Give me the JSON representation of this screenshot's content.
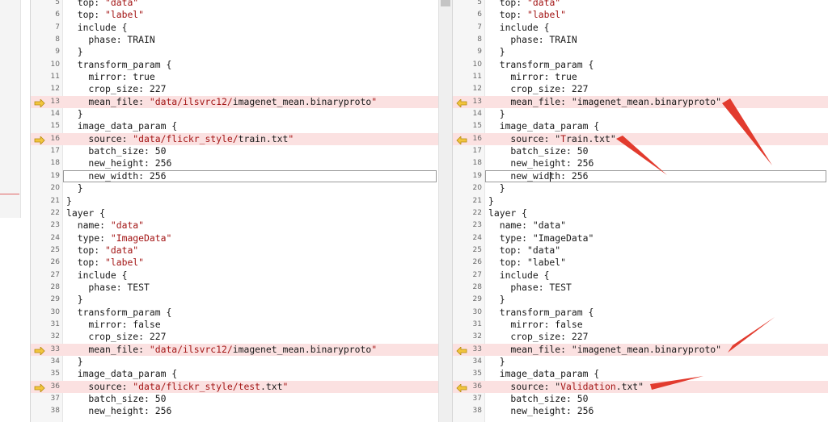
{
  "left_pane": {
    "lines": [
      {
        "n": "5",
        "segs": [
          {
            "t": "  top: "
          },
          {
            "t": "\"data\"",
            "s": 1
          }
        ]
      },
      {
        "n": "6",
        "segs": [
          {
            "t": "  top: "
          },
          {
            "t": "\"label\"",
            "s": 1
          }
        ]
      },
      {
        "n": "7",
        "segs": [
          {
            "t": "  include {"
          }
        ]
      },
      {
        "n": "8",
        "segs": [
          {
            "t": "    phase: TRAIN"
          }
        ]
      },
      {
        "n": "9",
        "segs": [
          {
            "t": "  }"
          }
        ]
      },
      {
        "n": "10",
        "segs": [
          {
            "t": "  transform_param {"
          }
        ]
      },
      {
        "n": "11",
        "segs": [
          {
            "t": "    mirror: true"
          }
        ]
      },
      {
        "n": "12",
        "segs": [
          {
            "t": "    crop_size: 227"
          }
        ]
      },
      {
        "n": "13",
        "changed": true,
        "segs": [
          {
            "t": "    mean_file: "
          },
          {
            "t": "\"data/ilsvrc12/",
            "s": 1
          },
          {
            "t": "imagenet_mean.binaryproto"
          },
          {
            "t": "\"",
            "s": 1
          }
        ]
      },
      {
        "n": "14",
        "segs": [
          {
            "t": "  }"
          }
        ]
      },
      {
        "n": "15",
        "segs": [
          {
            "t": "  image_data_param {"
          }
        ]
      },
      {
        "n": "16",
        "changed": true,
        "segs": [
          {
            "t": "    source: "
          },
          {
            "t": "\"data/flickr_style/",
            "s": 1
          },
          {
            "t": "train.txt"
          },
          {
            "t": "\"",
            "s": 1
          }
        ]
      },
      {
        "n": "17",
        "segs": [
          {
            "t": "    batch_size: 50"
          }
        ]
      },
      {
        "n": "18",
        "segs": [
          {
            "t": "    new_height: 256"
          }
        ]
      },
      {
        "n": "19",
        "boxed": true,
        "segs": [
          {
            "t": "    new_width: 256"
          }
        ]
      },
      {
        "n": "20",
        "segs": [
          {
            "t": "  }"
          }
        ]
      },
      {
        "n": "21",
        "segs": [
          {
            "t": "}"
          }
        ]
      },
      {
        "n": "22",
        "segs": [
          {
            "t": "layer {"
          }
        ]
      },
      {
        "n": "23",
        "segs": [
          {
            "t": "  name: "
          },
          {
            "t": "\"data\"",
            "s": 1
          }
        ]
      },
      {
        "n": "24",
        "segs": [
          {
            "t": "  type: "
          },
          {
            "t": "\"ImageData\"",
            "s": 1
          }
        ]
      },
      {
        "n": "25",
        "segs": [
          {
            "t": "  top: "
          },
          {
            "t": "\"data\"",
            "s": 1
          }
        ]
      },
      {
        "n": "26",
        "segs": [
          {
            "t": "  top: "
          },
          {
            "t": "\"label\"",
            "s": 1
          }
        ]
      },
      {
        "n": "27",
        "segs": [
          {
            "t": "  include {"
          }
        ]
      },
      {
        "n": "28",
        "segs": [
          {
            "t": "    phase: TEST"
          }
        ]
      },
      {
        "n": "29",
        "segs": [
          {
            "t": "  }"
          }
        ]
      },
      {
        "n": "30",
        "segs": [
          {
            "t": "  transform_param {"
          }
        ]
      },
      {
        "n": "31",
        "segs": [
          {
            "t": "    mirror: false"
          }
        ]
      },
      {
        "n": "32",
        "segs": [
          {
            "t": "    crop_size: 227"
          }
        ]
      },
      {
        "n": "33",
        "changed": true,
        "segs": [
          {
            "t": "    mean_file: "
          },
          {
            "t": "\"data/ilsvrc12/",
            "s": 1
          },
          {
            "t": "imagenet_mean.binaryproto"
          },
          {
            "t": "\"",
            "s": 1
          }
        ]
      },
      {
        "n": "34",
        "segs": [
          {
            "t": "  }"
          }
        ]
      },
      {
        "n": "35",
        "segs": [
          {
            "t": "  image_data_param {"
          }
        ]
      },
      {
        "n": "36",
        "changed": true,
        "segs": [
          {
            "t": "    source: "
          },
          {
            "t": "\"data/flickr_style/test",
            "s": 1
          },
          {
            "t": ".txt"
          },
          {
            "t": "\"",
            "s": 1
          }
        ]
      },
      {
        "n": "37",
        "segs": [
          {
            "t": "    batch_size: 50"
          }
        ]
      },
      {
        "n": "38",
        "segs": [
          {
            "t": "    new_height: 256"
          }
        ]
      }
    ]
  },
  "right_pane": {
    "lines": [
      {
        "n": "5",
        "segs": [
          {
            "t": "  top: "
          },
          {
            "t": "\"data\"",
            "s": 1
          }
        ]
      },
      {
        "n": "6",
        "segs": [
          {
            "t": "  top: "
          },
          {
            "t": "\"label\"",
            "s": 1
          }
        ]
      },
      {
        "n": "7",
        "segs": [
          {
            "t": "  include {"
          }
        ]
      },
      {
        "n": "8",
        "segs": [
          {
            "t": "    phase: TRAIN"
          }
        ]
      },
      {
        "n": "9",
        "segs": [
          {
            "t": "  }"
          }
        ]
      },
      {
        "n": "10",
        "segs": [
          {
            "t": "  transform_param {"
          }
        ]
      },
      {
        "n": "11",
        "segs": [
          {
            "t": "    mirror: true"
          }
        ]
      },
      {
        "n": "12",
        "segs": [
          {
            "t": "    crop_size: 227"
          }
        ]
      },
      {
        "n": "13",
        "changed": true,
        "segs": [
          {
            "t": "    mean_file: \"imagenet_mean.binaryproto\""
          }
        ]
      },
      {
        "n": "14",
        "segs": [
          {
            "t": "  }"
          }
        ]
      },
      {
        "n": "15",
        "segs": [
          {
            "t": "  image_data_param {"
          }
        ]
      },
      {
        "n": "16",
        "changed": true,
        "segs": [
          {
            "t": "    source: \""
          },
          {
            "t": "T",
            "s": 1
          },
          {
            "t": "rain.txt\""
          }
        ]
      },
      {
        "n": "17",
        "segs": [
          {
            "t": "    batch_size: 50"
          }
        ]
      },
      {
        "n": "18",
        "segs": [
          {
            "t": "    new_height: 256"
          }
        ]
      },
      {
        "n": "19",
        "boxed": true,
        "caret": true,
        "segs": [
          {
            "t": "    new_width: 256"
          }
        ]
      },
      {
        "n": "20",
        "segs": [
          {
            "t": "  }"
          }
        ]
      },
      {
        "n": "21",
        "segs": [
          {
            "t": "}"
          }
        ]
      },
      {
        "n": "22",
        "segs": [
          {
            "t": "layer {"
          }
        ]
      },
      {
        "n": "23",
        "segs": [
          {
            "t": "  name: \"data\""
          }
        ]
      },
      {
        "n": "24",
        "segs": [
          {
            "t": "  type: \"ImageData\""
          }
        ]
      },
      {
        "n": "25",
        "segs": [
          {
            "t": "  top: \"data\""
          }
        ]
      },
      {
        "n": "26",
        "segs": [
          {
            "t": "  top: \"label\""
          }
        ]
      },
      {
        "n": "27",
        "segs": [
          {
            "t": "  include {"
          }
        ]
      },
      {
        "n": "28",
        "segs": [
          {
            "t": "    phase: TEST"
          }
        ]
      },
      {
        "n": "29",
        "segs": [
          {
            "t": "  }"
          }
        ]
      },
      {
        "n": "30",
        "segs": [
          {
            "t": "  transform_param {"
          }
        ]
      },
      {
        "n": "31",
        "segs": [
          {
            "t": "    mirror: false"
          }
        ]
      },
      {
        "n": "32",
        "segs": [
          {
            "t": "    crop_size: 227"
          }
        ]
      },
      {
        "n": "33",
        "changed": true,
        "segs": [
          {
            "t": "    mean_file: \"imagenet_mean.binaryproto\""
          }
        ]
      },
      {
        "n": "34",
        "segs": [
          {
            "t": "  }"
          }
        ]
      },
      {
        "n": "35",
        "segs": [
          {
            "t": "  image_data_param {"
          }
        ]
      },
      {
        "n": "36",
        "changed": true,
        "segs": [
          {
            "t": "    source: \""
          },
          {
            "t": "Validation",
            "s": 1
          },
          {
            "t": ".txt\""
          }
        ]
      },
      {
        "n": "37",
        "segs": [
          {
            "t": "    batch_size: 50"
          }
        ]
      },
      {
        "n": "38",
        "segs": [
          {
            "t": "    new_height: 256"
          }
        ]
      }
    ]
  },
  "icons": {
    "left_change_marker": "arrow-right-icon",
    "right_change_marker": "arrow-left-icon"
  },
  "colors": {
    "changed_line_bg": "#fbe1e1",
    "string_text": "#a31515",
    "arrow_fill": "#f2c53d",
    "annotation_red": "#e23b2e"
  }
}
